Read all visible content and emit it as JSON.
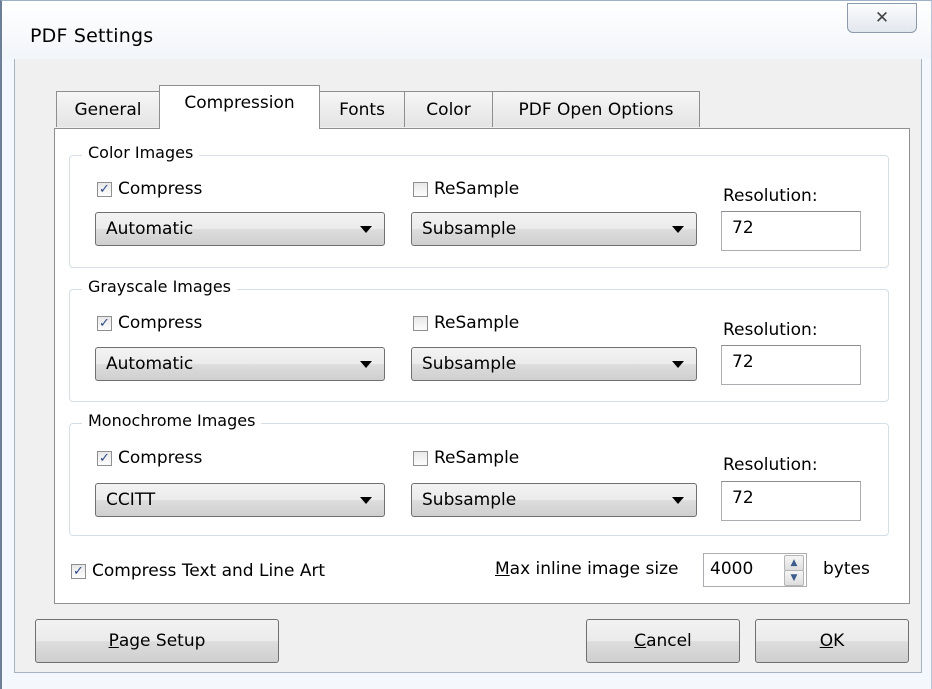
{
  "window": {
    "title": "PDF Settings",
    "close_glyph": "✕"
  },
  "tabs": [
    {
      "label": "General",
      "active": false
    },
    {
      "label": "Compression",
      "active": true
    },
    {
      "label": "Fonts",
      "active": false
    },
    {
      "label": "Color",
      "active": false
    },
    {
      "label": "PDF Open Options",
      "active": false
    }
  ],
  "groups": {
    "color": {
      "legend": "Color Images",
      "compress": {
        "label": "Compress",
        "checked": true
      },
      "resample": {
        "label": "ReSample",
        "checked": false
      },
      "method": "Automatic",
      "resample_method": "Subsample",
      "resolution_label": "Resolution:",
      "resolution": "72"
    },
    "grayscale": {
      "legend": "Grayscale Images",
      "compress": {
        "label": "Compress",
        "checked": true
      },
      "resample": {
        "label": "ReSample",
        "checked": false
      },
      "method": "Automatic",
      "resample_method": "Subsample",
      "resolution_label": "Resolution:",
      "resolution": "72"
    },
    "monochrome": {
      "legend": "Monochrome Images",
      "compress": {
        "label": "Compress",
        "checked": true
      },
      "resample": {
        "label": "ReSample",
        "checked": false
      },
      "method": "CCITT",
      "resample_method": "Subsample",
      "resolution_label": "Resolution:",
      "resolution": "72"
    }
  },
  "compress_text": {
    "label": "Compress Text and Line Art",
    "checked": true
  },
  "max_inline": {
    "label_first": "M",
    "label_rest": "ax inline image size",
    "value": "4000",
    "unit": "bytes"
  },
  "buttons": {
    "page_setup_first": "P",
    "page_setup_rest": "age Setup",
    "cancel_first": "C",
    "cancel_rest": "ancel",
    "ok_first": "O",
    "ok_rest": "K"
  }
}
